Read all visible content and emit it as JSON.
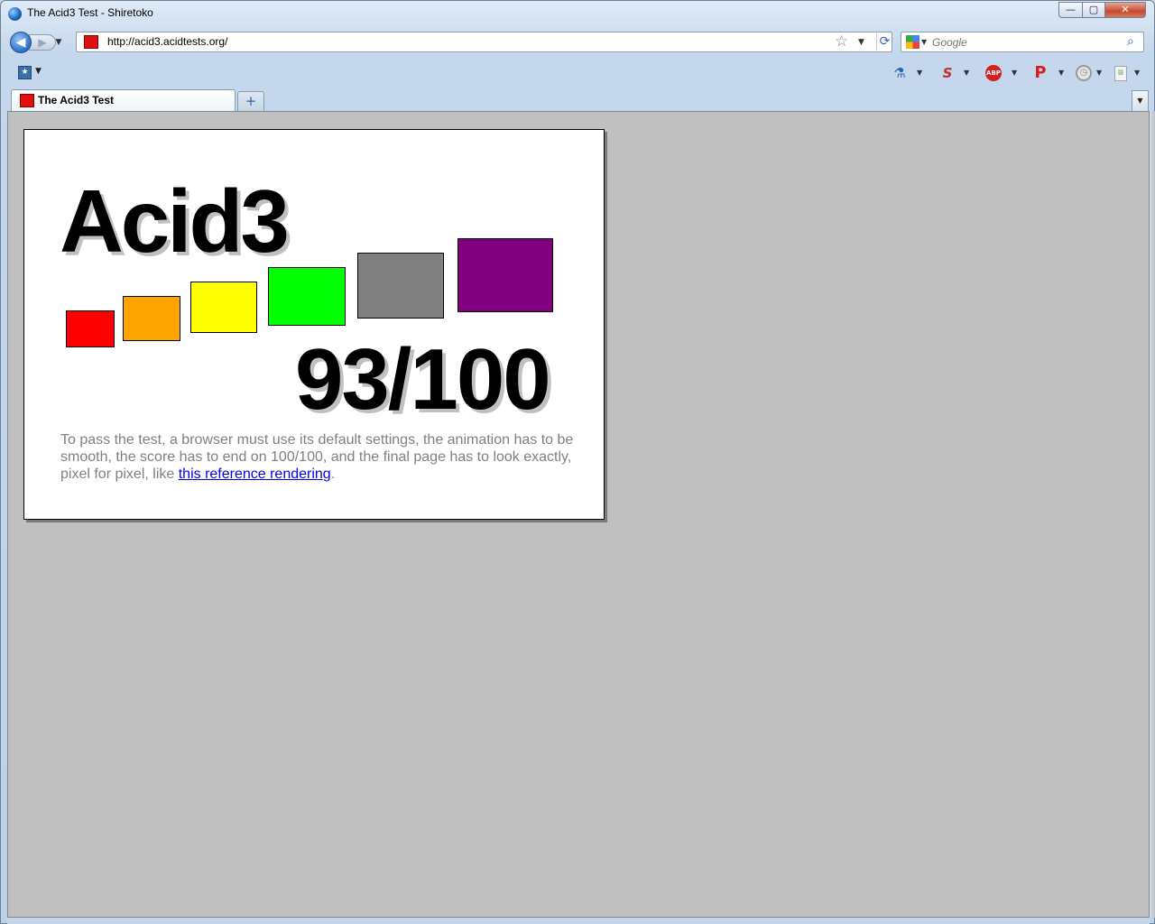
{
  "window": {
    "title": "The Acid3 Test - Shiretoko",
    "minimize_glyph": "—",
    "maximize_glyph": "▢",
    "close_glyph": "✕"
  },
  "navbar": {
    "back_glyph": "◀",
    "forward_glyph": "▶",
    "url": "http://acid3.acidtests.org/",
    "search_engine": "google-icon",
    "search_placeholder": "Google"
  },
  "tabs": [
    {
      "label": "The Acid3 Test",
      "active": true
    }
  ],
  "page": {
    "title": "Acid3",
    "score": "93/100",
    "buckets": [
      {
        "name": "bucket-1",
        "color": "#ff0000"
      },
      {
        "name": "bucket-2",
        "color": "#ffa500"
      },
      {
        "name": "bucket-3",
        "color": "#ffff00"
      },
      {
        "name": "bucket-4",
        "color": "#00ff00"
      },
      {
        "name": "bucket-5",
        "color": "#808080"
      },
      {
        "name": "bucket-6",
        "color": "#800080"
      }
    ],
    "instructions_text": "To pass the test, a browser must use its default settings, the animation has to be smooth, the score has to end on 100/100, and the final page has to look exactly, pixel for pixel, like ",
    "reference_link": "this reference rendering",
    "instructions_end": "."
  },
  "colors": {
    "viewport_bg": "#c0c0c0",
    "link": "#0000ee",
    "instructions": "#808080"
  }
}
